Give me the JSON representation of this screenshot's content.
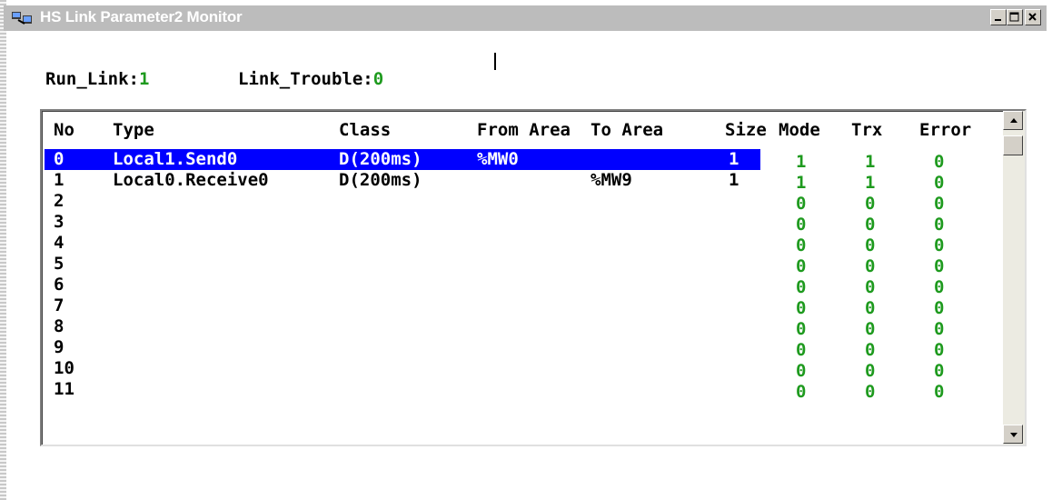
{
  "window": {
    "title": "HS Link Parameter2 Monitor",
    "buttons": {
      "minimize": "minimize-icon",
      "maximize": "maximize-icon",
      "close": "close-icon"
    }
  },
  "status": {
    "run_link_label": "Run_Link:",
    "run_link_value": "1",
    "link_trouble_label": "Link_Trouble:",
    "link_trouble_value": "0"
  },
  "table": {
    "headers": {
      "no": "No",
      "type": "Type",
      "class": "Class",
      "from_area": "From Area",
      "to_area": "To Area",
      "size": "Size",
      "mode": "Mode",
      "trx": "Trx",
      "error": "Error"
    },
    "selected_index": 0,
    "rows": [
      {
        "no": "0",
        "type": "Local1.Send0",
        "class": "D(200ms)",
        "from": "%MW0",
        "to": "",
        "size": "1",
        "mode": "1",
        "trx": "1",
        "error": "0"
      },
      {
        "no": "1",
        "type": "Local0.Receive0",
        "class": "D(200ms)",
        "from": "",
        "to": "%MW9",
        "size": "1",
        "mode": "1",
        "trx": "1",
        "error": "0"
      },
      {
        "no": "2",
        "type": "",
        "class": "",
        "from": "",
        "to": "",
        "size": "",
        "mode": "0",
        "trx": "0",
        "error": "0"
      },
      {
        "no": "3",
        "type": "",
        "class": "",
        "from": "",
        "to": "",
        "size": "",
        "mode": "0",
        "trx": "0",
        "error": "0"
      },
      {
        "no": "4",
        "type": "",
        "class": "",
        "from": "",
        "to": "",
        "size": "",
        "mode": "0",
        "trx": "0",
        "error": "0"
      },
      {
        "no": "5",
        "type": "",
        "class": "",
        "from": "",
        "to": "",
        "size": "",
        "mode": "0",
        "trx": "0",
        "error": "0"
      },
      {
        "no": "6",
        "type": "",
        "class": "",
        "from": "",
        "to": "",
        "size": "",
        "mode": "0",
        "trx": "0",
        "error": "0"
      },
      {
        "no": "7",
        "type": "",
        "class": "",
        "from": "",
        "to": "",
        "size": "",
        "mode": "0",
        "trx": "0",
        "error": "0"
      },
      {
        "no": "8",
        "type": "",
        "class": "",
        "from": "",
        "to": "",
        "size": "",
        "mode": "0",
        "trx": "0",
        "error": "0"
      },
      {
        "no": "9",
        "type": "",
        "class": "",
        "from": "",
        "to": "",
        "size": "",
        "mode": "0",
        "trx": "0",
        "error": "0"
      },
      {
        "no": "10",
        "type": "",
        "class": "",
        "from": "",
        "to": "",
        "size": "",
        "mode": "0",
        "trx": "0",
        "error": "0"
      },
      {
        "no": "11",
        "type": "",
        "class": "",
        "from": "",
        "to": "",
        "size": "",
        "mode": "0",
        "trx": "0",
        "error": "0"
      }
    ]
  },
  "colors": {
    "selection": "#0000ff",
    "status_value": "#1e9a1e",
    "title_bar": "#bcbcbc"
  }
}
